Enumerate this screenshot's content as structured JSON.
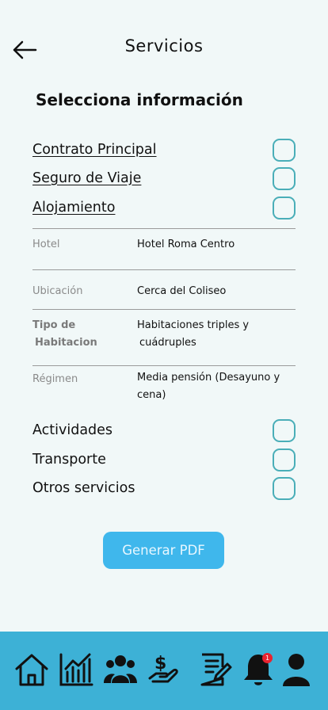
{
  "header": {
    "title": "Servicios",
    "back_icon": "arrow-left-icon"
  },
  "section": {
    "title": "Selecciona información"
  },
  "options_top": [
    {
      "label": "Contrato Principal",
      "checked": false
    },
    {
      "label": "Seguro de Viaje",
      "checked": false
    },
    {
      "label": "Alojamiento",
      "checked": false
    }
  ],
  "details": [
    {
      "label": "Hotel",
      "value": "Hotel Roma Centro"
    },
    {
      "label": "Ubicación",
      "value": "Cerca del Coliseo"
    },
    {
      "label_line1": "Tipo de",
      "label_line2": "Habitacion",
      "value_line1": "Habitaciones triples y",
      "value_line2": "cuádruples"
    },
    {
      "label": "Régimen",
      "value_line1": "Media pensión (Desayuno y",
      "value_line2": "cena)"
    }
  ],
  "options_bottom": [
    {
      "label": "Actividades",
      "checked": false
    },
    {
      "label": "Transporte",
      "checked": false
    },
    {
      "label": "Otros servicios",
      "checked": false
    }
  ],
  "button": {
    "label": "Generar PDF"
  },
  "bottom_nav": {
    "items": [
      "home-icon",
      "chart-icon",
      "users-icon",
      "payment-icon",
      "document-edit-icon",
      "bell-icon",
      "profile-icon"
    ],
    "notification_count": "1"
  },
  "colors": {
    "background": "#f1f8f8",
    "accent": "#4aaeb8",
    "button": "#3fb7ec",
    "nav_bar": "#3db1d6",
    "badge": "#e8232f"
  }
}
